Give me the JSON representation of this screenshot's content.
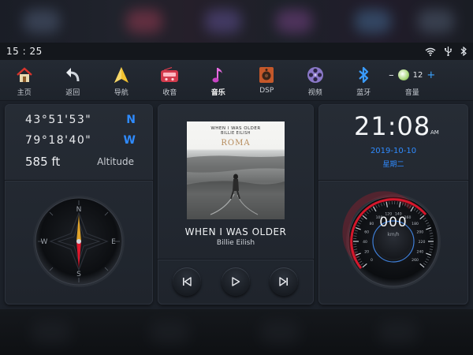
{
  "status_bar": {
    "time": "15 : 25",
    "icons": [
      "wifi-icon",
      "usb-icon",
      "bluetooth-icon"
    ]
  },
  "nav": {
    "items": [
      {
        "label": "主页",
        "icon": "home-icon"
      },
      {
        "label": "返回",
        "icon": "back-arrow-icon"
      },
      {
        "label": "导航",
        "icon": "navigation-icon"
      },
      {
        "label": "收音",
        "icon": "radio-icon"
      },
      {
        "label": "音乐",
        "icon": "music-note-icon",
        "active": true
      },
      {
        "label": "DSP",
        "icon": "dsp-speaker-icon"
      },
      {
        "label": "视频",
        "icon": "film-reel-icon"
      },
      {
        "label": "蓝牙",
        "icon": "bluetooth-icon"
      }
    ],
    "volume": {
      "label": "音量",
      "minus": "–",
      "plus": "+",
      "level": "12"
    }
  },
  "gps": {
    "latitude": "43°51'53\"",
    "latitude_dir": "N",
    "longitude": "79°18'40\"",
    "longitude_dir": "W",
    "altitude": "585 ft",
    "altitude_label": "Altitude",
    "compass_letters": [
      "N",
      "E",
      "S",
      "W"
    ]
  },
  "music": {
    "album_line1": "WHEN I WAS OLDER",
    "album_line2": "BILLIE EILISH",
    "album_title": "ROMA",
    "song_title": "WHEN I WAS OLDER",
    "artist": "Billie Eilish",
    "controls": [
      "previous-icon",
      "play-icon",
      "next-icon"
    ]
  },
  "clock": {
    "time": "21:08",
    "ampm": "AM",
    "date": "2019-10-10",
    "weekday": "星期二"
  },
  "speedometer": {
    "value": "000",
    "unit": "km/h",
    "ticks": [
      "0",
      "20",
      "40",
      "60",
      "80",
      "100",
      "120",
      "140",
      "160",
      "180",
      "200",
      "220",
      "240",
      "260"
    ],
    "colors": {
      "accent": "#e0182d",
      "ring": "#3a3f48"
    }
  },
  "colors": {
    "accent_blue": "#2f8bff",
    "panel": "#262c35"
  }
}
